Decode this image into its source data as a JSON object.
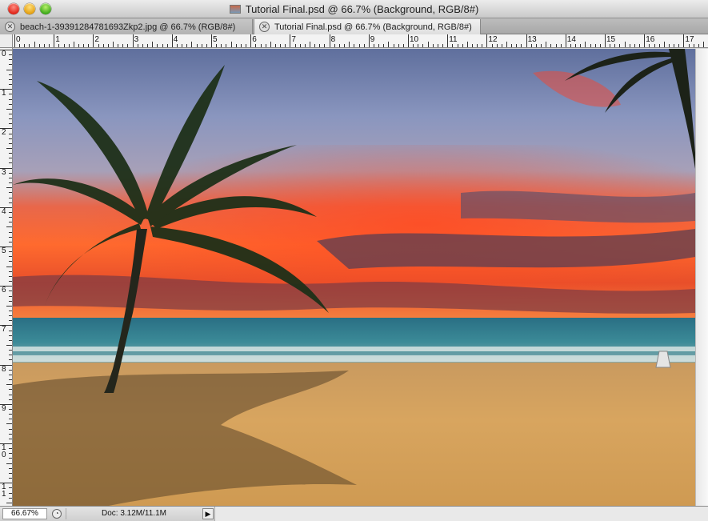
{
  "window": {
    "title": "Tutorial Final.psd @ 66.7% (Background, RGB/8#)"
  },
  "tabs": [
    {
      "label": "beach-1-39391284781693Zkp2.jpg @ 66.7% (RGB/8#)",
      "active": false
    },
    {
      "label": "Tutorial Final.psd @ 66.7% (Background, RGB/8#)",
      "active": true
    }
  ],
  "rulers": {
    "horizontal": [
      "0",
      "1",
      "2",
      "3",
      "4",
      "5",
      "6",
      "7",
      "8",
      "9",
      "10",
      "11",
      "12",
      "13",
      "14",
      "15",
      "16",
      "17"
    ],
    "vertical": [
      "0",
      "1",
      "2",
      "3",
      "4",
      "5",
      "6",
      "7",
      "8",
      "9",
      "1 0",
      "1 1"
    ]
  },
  "status": {
    "zoom": "66.67%",
    "doc_info": "Doc: 3.12M/11.1M",
    "menu_arrow": "▶"
  },
  "canvas": {
    "image_description_icon": "beach-sunset-image",
    "colors": {
      "sky_top": "#7f8fb8",
      "sky_red": "#ff5a2a",
      "sea": "#2f7f8f",
      "sand": "#d5a15c"
    }
  }
}
